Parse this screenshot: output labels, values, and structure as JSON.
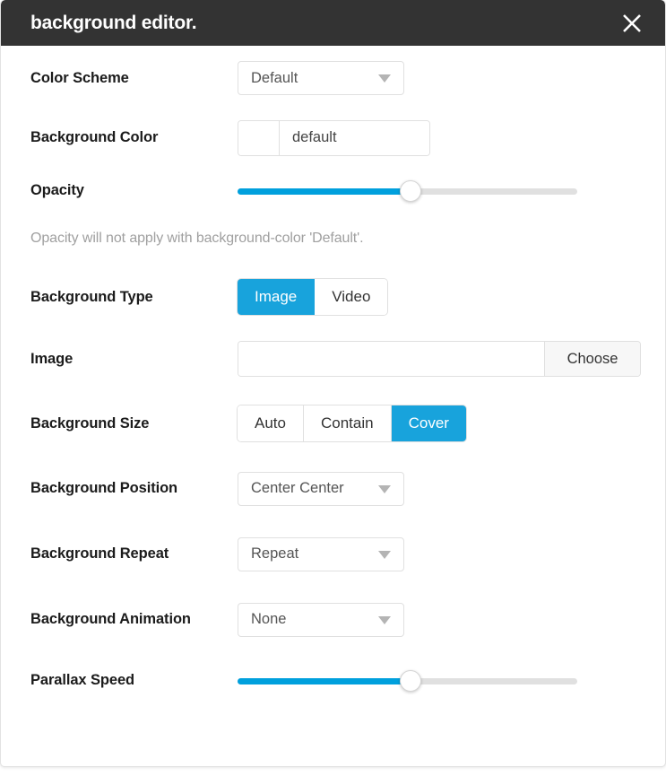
{
  "window": {
    "title": "background editor.",
    "close_icon": "close-icon"
  },
  "fields": {
    "color_scheme": {
      "label": "Color Scheme",
      "value": "Default",
      "caret_icon": "chevron-down-icon"
    },
    "background_color": {
      "label": "Background Color",
      "swatch_color": "#ffffff",
      "value": "default"
    },
    "opacity": {
      "label": "Opacity",
      "value": "50",
      "percent": 51,
      "help": "Opacity will not apply with background-color 'Default'."
    },
    "background_type": {
      "label": "Background Type",
      "options": [
        "Image",
        "Video"
      ],
      "selected": "Image"
    },
    "image": {
      "label": "Image",
      "value": "",
      "button_label": "Choose"
    },
    "background_size": {
      "label": "Background Size",
      "options": [
        "Auto",
        "Contain",
        "Cover"
      ],
      "selected": "Cover"
    },
    "background_position": {
      "label": "Background Position",
      "value": "Center Center",
      "caret_icon": "chevron-down-icon"
    },
    "background_repeat": {
      "label": "Background Repeat",
      "value": "Repeat",
      "caret_icon": "chevron-down-icon"
    },
    "background_animation": {
      "label": "Background Animation",
      "value": "None",
      "caret_icon": "chevron-down-icon"
    },
    "parallax_speed": {
      "label": "Parallax Speed",
      "value": "0",
      "percent": 51
    }
  },
  "theme": {
    "accent": "#00a0dd",
    "accent_button": "#18a3dc",
    "header_bg": "#333333",
    "border": "#e0e0e0",
    "muted_text": "#a0a0a0"
  }
}
